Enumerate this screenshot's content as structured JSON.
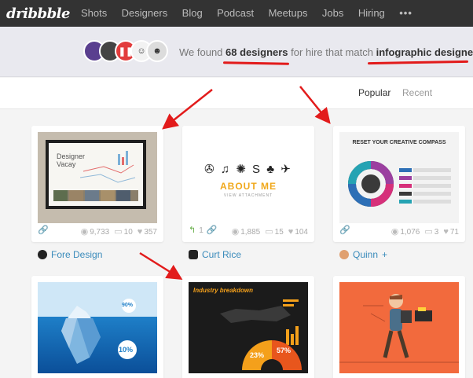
{
  "nav": {
    "logo": "dribbble",
    "items": [
      "Shots",
      "Designers",
      "Blog",
      "Podcast",
      "Meetups",
      "Jobs",
      "Hiring"
    ],
    "more": "•••"
  },
  "banner": {
    "prefix": "We found",
    "count": "68 designers",
    "middle": "for hire that match",
    "query": "infographic designer",
    "suffix": "."
  },
  "tabs": {
    "popular": "Popular",
    "recent": "Recent"
  },
  "cards": [
    {
      "thumb_title": "Designer Vacay",
      "views": "9,733",
      "comments": "10",
      "likes": "357",
      "rebounds": "",
      "designer": "Fore Design"
    },
    {
      "thumb_title": "ABOUT ME",
      "thumb_sub": "VIEW ATTACHMENT",
      "views": "1,885",
      "comments": "15",
      "likes": "104",
      "rebounds": "1",
      "designer": "Curt Rice"
    },
    {
      "thumb_title": "RESET YOUR CREATIVE COMPASS",
      "views": "1,076",
      "comments": "3",
      "likes": "71",
      "rebounds": "",
      "designer": "Quinn",
      "designer_suffix": "+"
    },
    {
      "thumb_pct1": "90%",
      "thumb_pct2": "10%"
    },
    {
      "thumb_title": "Industry breakdown",
      "thumb_pct1": "57%",
      "thumb_pct2": "23%"
    },
    {}
  ],
  "colors": {
    "nav_bg": "#333333",
    "accent": "#e21b1b",
    "link": "#3a8bbb",
    "pink": "#ea4c89"
  }
}
